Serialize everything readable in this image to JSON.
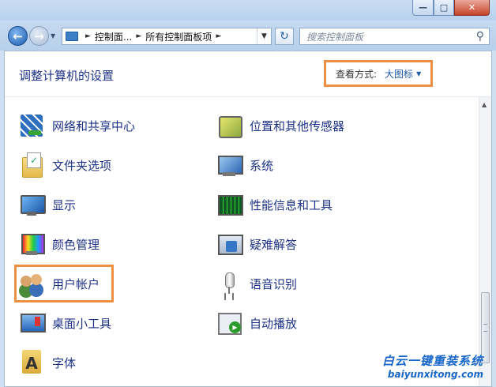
{
  "window": {
    "min_glyph": "—",
    "max_glyph": "□",
    "close_glyph": "✕"
  },
  "nav": {
    "address": [
      "控制面...",
      "所有控制面板项"
    ],
    "search_placeholder": "搜索控制面板"
  },
  "header": {
    "title": "调整计算机的设置",
    "view_by_label": "查看方式:",
    "view_by_value": "大图标"
  },
  "items_left": [
    {
      "label": "网络和共享中心",
      "icon": "network-icon"
    },
    {
      "label": "文件夹选项",
      "icon": "folder-options-icon"
    },
    {
      "label": "显示",
      "icon": "display-icon"
    },
    {
      "label": "颜色管理",
      "icon": "color-management-icon"
    },
    {
      "label": "用户帐户",
      "icon": "user-accounts-icon"
    },
    {
      "label": "桌面小工具",
      "icon": "gadgets-icon"
    },
    {
      "label": "字体",
      "icon": "fonts-icon"
    }
  ],
  "items_right": [
    {
      "label": "位置和其他传感器",
      "icon": "location-sensors-icon"
    },
    {
      "label": "系统",
      "icon": "system-icon"
    },
    {
      "label": "性能信息和工具",
      "icon": "performance-icon"
    },
    {
      "label": "疑难解答",
      "icon": "troubleshooting-icon"
    },
    {
      "label": "语音识别",
      "icon": "speech-recognition-icon"
    },
    {
      "label": "自动播放",
      "icon": "autoplay-icon"
    }
  ],
  "watermark": {
    "text": "白云一键重装系统",
    "url": "baiyunxitong.com"
  },
  "colors": {
    "link": "#1e3287",
    "highlight_border": "#ee9043"
  }
}
